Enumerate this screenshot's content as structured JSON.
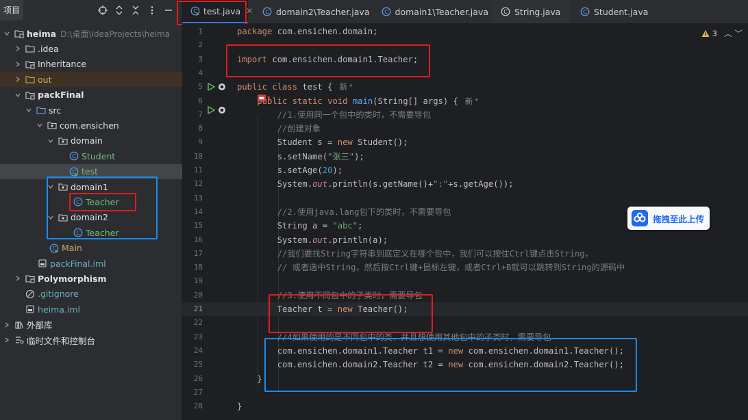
{
  "project_panel": {
    "title": "项目",
    "tree": [
      {
        "label": "heima",
        "path": "D:\\桌面\\IdeaProjects\\heima",
        "icon": "module-folder-icon",
        "bold": true
      },
      {
        "label": ".idea",
        "icon": "folder-icon"
      },
      {
        "label": "Inheritance",
        "icon": "module-folder-icon"
      },
      {
        "label": "out",
        "icon": "excluded-folder-icon"
      },
      {
        "label": "packFinal",
        "icon": "module-folder-icon",
        "bold": true
      },
      {
        "label": "src",
        "icon": "source-folder-icon"
      },
      {
        "label": "com.ensichen",
        "icon": "package-icon"
      },
      {
        "label": "domain",
        "icon": "package-icon"
      },
      {
        "label": "Student",
        "icon": "class-icon"
      },
      {
        "label": "test",
        "icon": "runnable-class-icon"
      },
      {
        "label": "domain1",
        "icon": "package-icon"
      },
      {
        "label": "Teacher",
        "icon": "class-icon"
      },
      {
        "label": "domain2",
        "icon": "package-icon"
      },
      {
        "label": "Teacher",
        "icon": "class-icon"
      },
      {
        "label": "Main",
        "icon": "runnable-class-icon"
      },
      {
        "label": "packFinal.iml",
        "icon": "iml-file-icon"
      },
      {
        "label": "Polymorphism",
        "icon": "module-folder-icon",
        "bold": true
      },
      {
        "label": ".gitignore",
        "icon": "ignore-file-icon"
      },
      {
        "label": "heima.iml",
        "icon": "iml-file-icon"
      },
      {
        "label": "外部库",
        "icon": "library-icon"
      },
      {
        "label": "临时文件和控制台",
        "icon": "scratches-icon"
      }
    ]
  },
  "tabs": [
    {
      "label": "test.java",
      "active": true
    },
    {
      "label": "domain2\\Teacher.java",
      "active": false
    },
    {
      "label": "domain1\\Teacher.java",
      "active": false
    },
    {
      "label": "String.java",
      "active": false
    },
    {
      "label": "Student.java",
      "active": false
    }
  ],
  "editor": {
    "warning_count": "3",
    "current_line": 21,
    "hints": {
      "new_star": "新 *"
    },
    "lines": [
      {
        "n": 1,
        "text": "package com.ensichen.domain;"
      },
      {
        "n": 2,
        "text": ""
      },
      {
        "n": 3,
        "text": "import com.ensichen.domain1.Teacher;"
      },
      {
        "n": 4,
        "text": ""
      },
      {
        "n": 5,
        "text": "public class test {"
      },
      {
        "n": 6,
        "text": "    public static void main(String[] args) {"
      },
      {
        "n": 7,
        "text": "        //1.使用同一个包中的类时，不需要导包"
      },
      {
        "n": 8,
        "text": "        //创建对象"
      },
      {
        "n": 9,
        "text": "        Student s = new Student();"
      },
      {
        "n": 10,
        "text": "        s.setName(\"张三\");"
      },
      {
        "n": 11,
        "text": "        s.setAge(20);"
      },
      {
        "n": 12,
        "text": "        System.out.println(s.getName()+\":\"+s.getAge());"
      },
      {
        "n": 13,
        "text": ""
      },
      {
        "n": 14,
        "text": "        //2.使用java.lang包下的类时，不需要导包"
      },
      {
        "n": 15,
        "text": "        String a = \"abc\";"
      },
      {
        "n": 16,
        "text": "        System.out.println(a);"
      },
      {
        "n": 17,
        "text": "        //我们要找String字符串到底定义在哪个包中，我们可以按住Ctrl键点击String，"
      },
      {
        "n": 18,
        "text": "        // 或者选中String，然后按Ctrl键+鼠标左键，或者Ctrl+B就可以跳转到String的源码中"
      },
      {
        "n": 19,
        "text": ""
      },
      {
        "n": 20,
        "text": "        //3.使用不同包中的子类时，需要导包"
      },
      {
        "n": 21,
        "text": "        Teacher t = new Teacher();"
      },
      {
        "n": 22,
        "text": ""
      },
      {
        "n": 23,
        "text": "        //4如果使用的是不同包中的类，并且想使用其他包中的子类时，需要导包"
      },
      {
        "n": 24,
        "text": "        com.ensichen.domain1.Teacher t1 = new com.ensichen.domain1.Teacher();"
      },
      {
        "n": 25,
        "text": "        com.ensichen.domain2.Teacher t2 = new com.ensichen.domain2.Teacher();"
      },
      {
        "n": 26,
        "text": "    }"
      },
      {
        "n": 27,
        "text": ""
      },
      {
        "n": 28,
        "text": "}"
      }
    ]
  },
  "upload_widget": {
    "label": "拖拽至此上传"
  },
  "colors": {
    "accent": "#3574f0",
    "highlight_red": "#e11d1d",
    "highlight_blue": "#1a8cf0"
  }
}
